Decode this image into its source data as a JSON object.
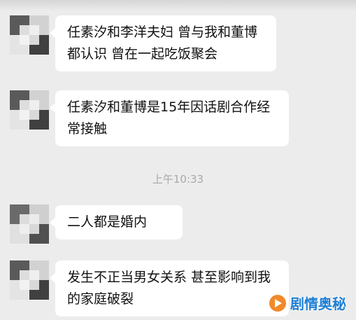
{
  "chat": {
    "messages": [
      {
        "text": "任素汐和李洋夫妇 曾与我和董博都认识 曾在一起吃饭聚会"
      },
      {
        "text": "任素汐和董博是15年因话剧合作经常接触"
      },
      {
        "text": "二人都是婚内"
      },
      {
        "text": "发生不正当男女关系 甚至影响到我的家庭破裂"
      }
    ],
    "timestamp": "上午10:33"
  },
  "watermark": {
    "text": "剧情奥秘",
    "icon": "play-logo-icon",
    "color": "#1e7fd6"
  }
}
